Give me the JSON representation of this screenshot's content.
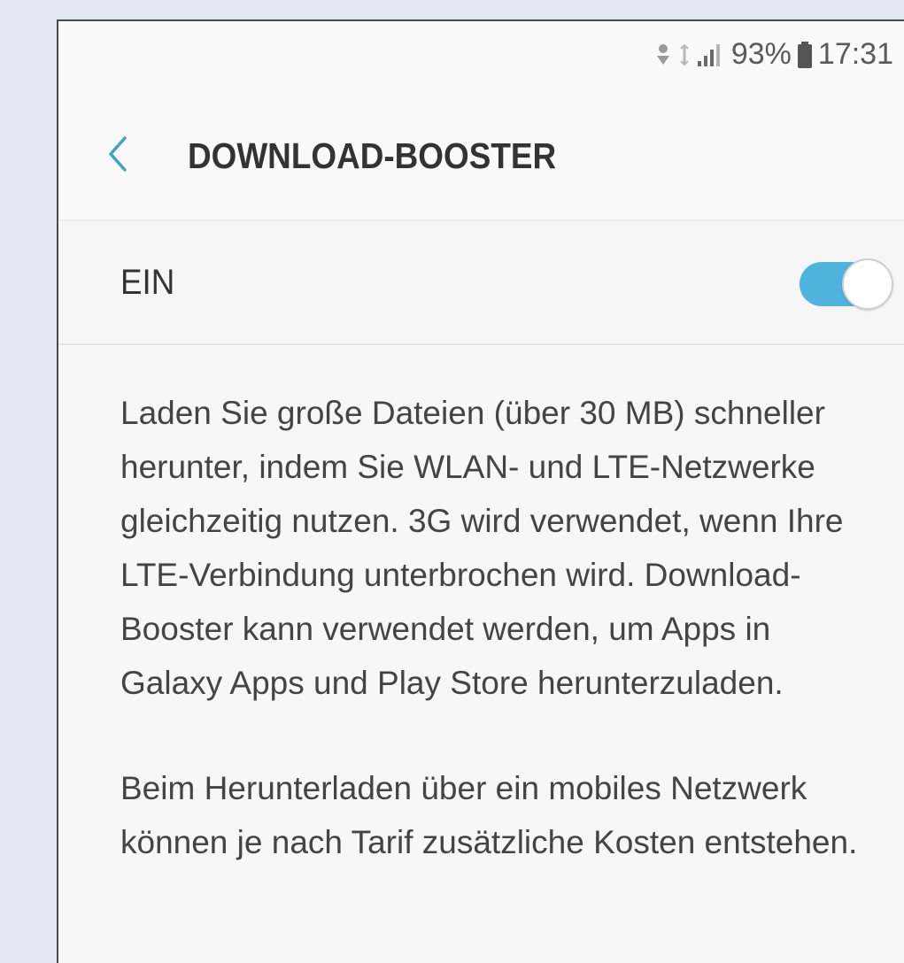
{
  "status_bar": {
    "battery_percent": "93%",
    "time": "17:31",
    "icons": [
      "data-transfer-icon",
      "wifi-signal-icon",
      "cellular-signal-icon",
      "battery-icon"
    ]
  },
  "app_bar": {
    "back_icon": "chevron-left-icon",
    "title": "DOWNLOAD-BOOSTER"
  },
  "master_switch": {
    "label": "EIN",
    "state": "on",
    "accent_color": "#4fb3dd"
  },
  "description": {
    "paragraph_1": "Laden Sie große Dateien (über 30 MB) schneller herunter, indem Sie WLAN- und LTE-Netzwerke gleichzeitig nutzen. 3G wird verwendet, wenn Ihre LTE-Verbindung unterbrochen wird. Download-Booster kann verwendet werden, um Apps in Galaxy Apps und Play Store herunterzuladen.",
    "paragraph_2": "Beim Herunterladen über ein mobiles Netzwerk können je nach Tarif zusätzliche Kosten entstehen."
  }
}
